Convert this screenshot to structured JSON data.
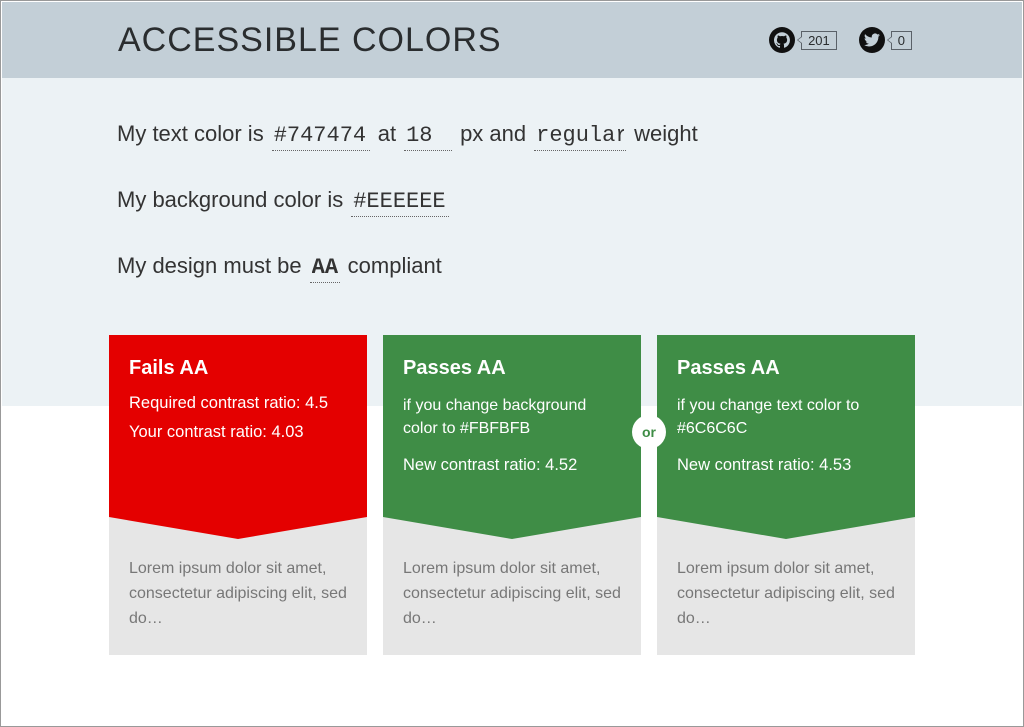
{
  "header": {
    "title": "ACCESSIBLE COLORS",
    "github_count": "201",
    "twitter_count": "0"
  },
  "form": {
    "line1_pre": "My text color is",
    "text_color": "#747474",
    "line1_at": "at",
    "font_size": "18",
    "line1_px": "px and",
    "font_weight": "regular",
    "line1_post": "weight",
    "line2_pre": "My background color is",
    "bg_color": "#EEEEEE",
    "line3_pre": "My design must be",
    "level": "AA",
    "line3_post": "compliant"
  },
  "cards": [
    {
      "status": "fail",
      "title": "Fails AA",
      "sub": "",
      "metric1_label": "Required contrast ratio:",
      "metric1_value": "4.5",
      "metric2_label": "Your contrast ratio:",
      "metric2_value": "4.03",
      "sample": "Lorem ipsum dolor sit amet, consectetur adipiscing elit, sed do…"
    },
    {
      "status": "pass",
      "title": "Passes AA",
      "sub": "if you change background color to #FBFBFB",
      "metric1_label": "New contrast ratio:",
      "metric1_value": "4.52",
      "sample": "Lorem ipsum dolor sit amet, consectetur adipiscing elit, sed do…"
    },
    {
      "status": "pass",
      "title": "Passes AA",
      "sub": "if you change text color to #6C6C6C",
      "metric1_label": "New contrast ratio:",
      "metric1_value": "4.53",
      "sample": "Lorem ipsum dolor sit amet, consectetur adipiscing elit, sed do…"
    }
  ],
  "or_label": "or"
}
